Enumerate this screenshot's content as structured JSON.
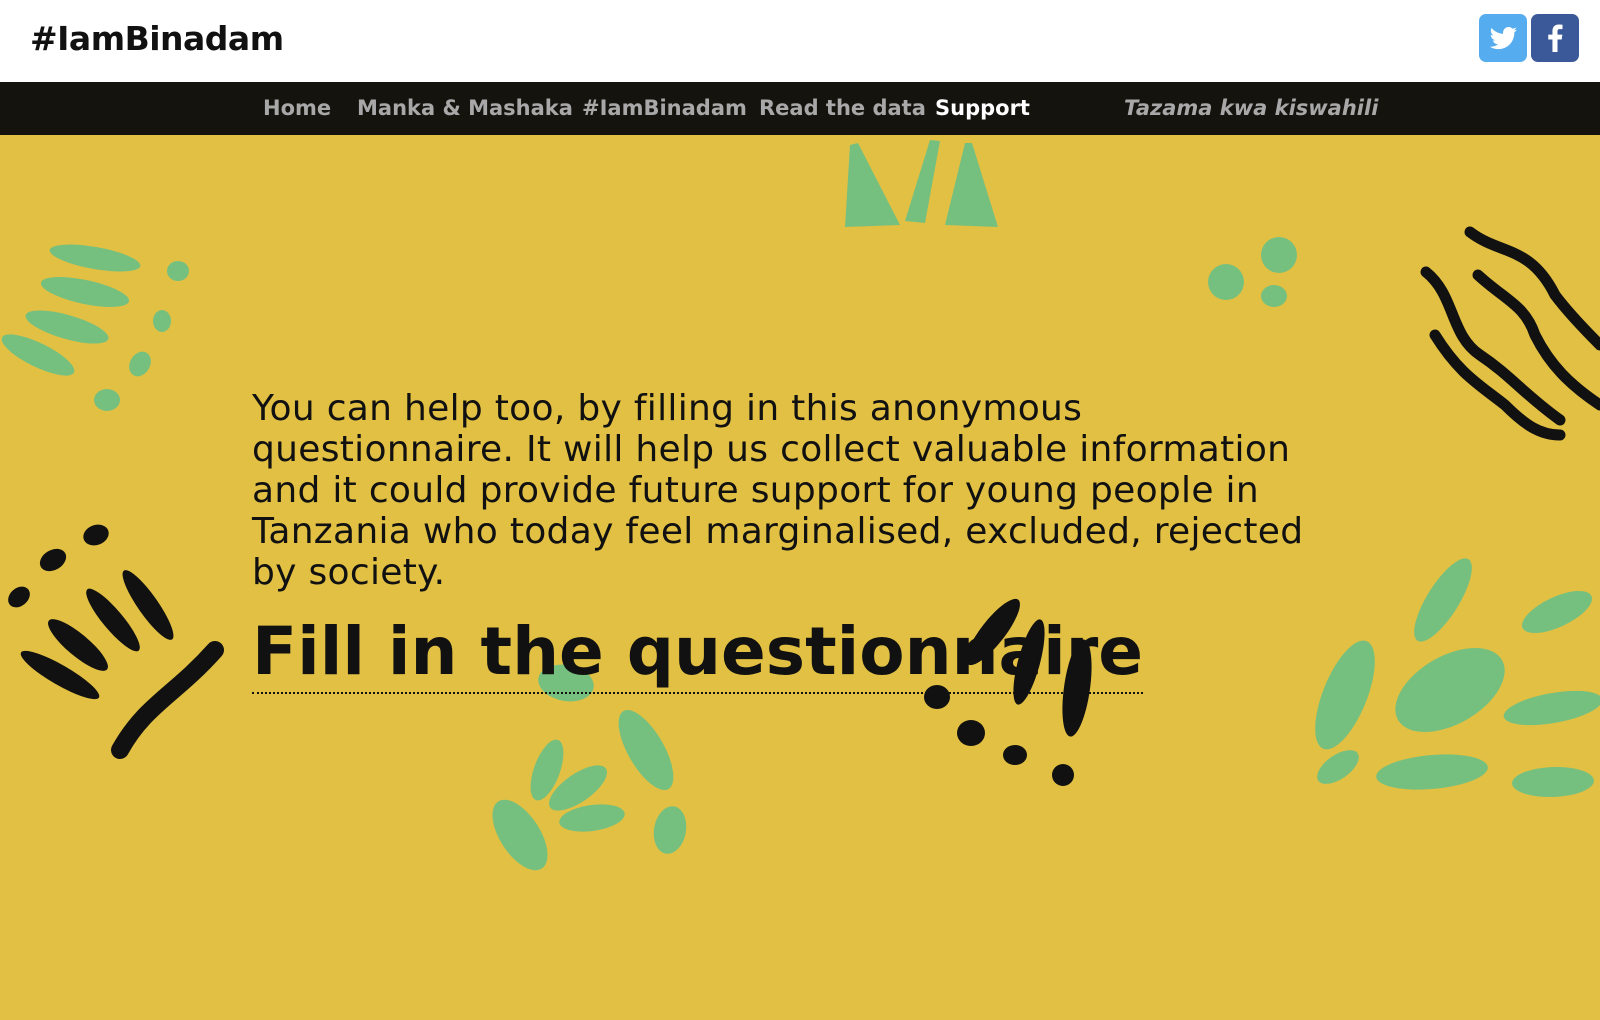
{
  "header": {
    "logo_text": "#IamBinadam",
    "social": [
      {
        "name": "twitter",
        "icon": "twitter-icon",
        "color": "#55acee"
      },
      {
        "name": "facebook",
        "icon": "facebook-icon",
        "color": "#3b5998"
      }
    ]
  },
  "nav": {
    "items": [
      {
        "label": "Home"
      },
      {
        "label": "Manka & Mashaka"
      },
      {
        "label": "#IamBinadam"
      },
      {
        "label": "Read the data"
      },
      {
        "label": "Support",
        "active": true
      }
    ],
    "language_link": "Tazama kwa kiswahili"
  },
  "main": {
    "body_text": "You can help too, by filling in this anonymous questionnaire. It will help us collect valuable information and it could provide future support for young people in Tanzania who today feel marginalised, excluded, rejected by society.",
    "cta_label": "Fill in the questionnaire"
  },
  "colors": {
    "background": "#e2c043",
    "nav_background": "#15130e",
    "accent_green": "#76c07f",
    "ink": "#111111"
  }
}
